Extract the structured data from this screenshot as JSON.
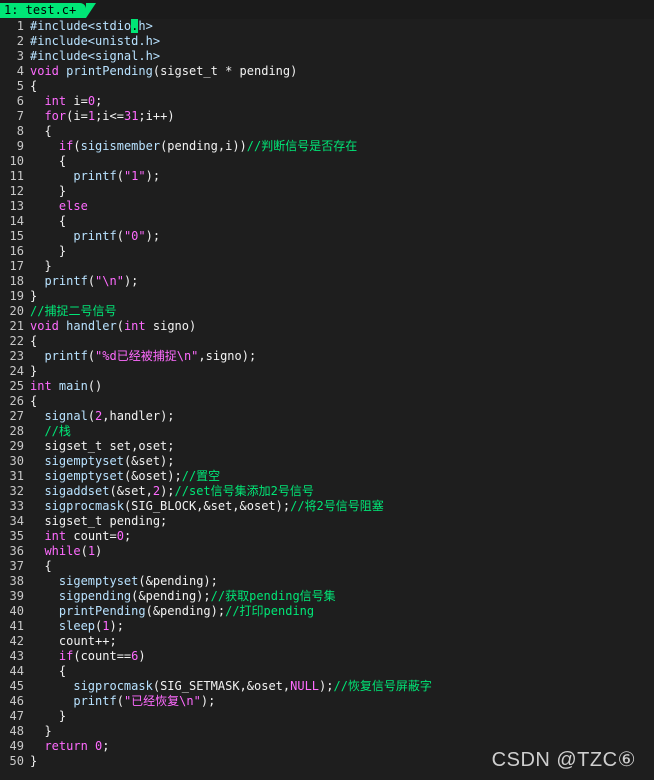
{
  "tab": {
    "label": "1: test.c+"
  },
  "lines": [
    {
      "n": "1",
      "tokens": [
        {
          "c": "pp",
          "t": "#include<stdio"
        },
        {
          "c": "cursor",
          "t": "."
        },
        {
          "c": "pp",
          "t": "h>"
        }
      ]
    },
    {
      "n": "2",
      "tokens": [
        {
          "c": "pp",
          "t": "#include<unistd.h>"
        }
      ]
    },
    {
      "n": "3",
      "tokens": [
        {
          "c": "pp",
          "t": "#include<signal.h>"
        }
      ]
    },
    {
      "n": "4",
      "tokens": [
        {
          "c": "kw",
          "t": "void"
        },
        {
          "c": "id",
          "t": " "
        },
        {
          "c": "fn",
          "t": "printPending"
        },
        {
          "c": "id",
          "t": "(sigset_t * pending)"
        }
      ]
    },
    {
      "n": "5",
      "tokens": [
        {
          "c": "id",
          "t": "{"
        }
      ]
    },
    {
      "n": "6",
      "tokens": [
        {
          "c": "id",
          "t": "  "
        },
        {
          "c": "kw",
          "t": "int"
        },
        {
          "c": "id",
          "t": " i="
        },
        {
          "c": "num",
          "t": "0"
        },
        {
          "c": "id",
          "t": ";"
        }
      ]
    },
    {
      "n": "7",
      "tokens": [
        {
          "c": "id",
          "t": "  "
        },
        {
          "c": "kw",
          "t": "for"
        },
        {
          "c": "id",
          "t": "(i="
        },
        {
          "c": "num",
          "t": "1"
        },
        {
          "c": "id",
          "t": ";i<="
        },
        {
          "c": "num",
          "t": "31"
        },
        {
          "c": "id",
          "t": ";i++)"
        }
      ]
    },
    {
      "n": "8",
      "tokens": [
        {
          "c": "id",
          "t": "  {"
        }
      ]
    },
    {
      "n": "9",
      "tokens": [
        {
          "c": "id",
          "t": "    "
        },
        {
          "c": "kw",
          "t": "if"
        },
        {
          "c": "id",
          "t": "("
        },
        {
          "c": "fn",
          "t": "sigismember"
        },
        {
          "c": "id",
          "t": "(pending,i))"
        },
        {
          "c": "cmt",
          "t": "//判断信号是否存在"
        }
      ]
    },
    {
      "n": "10",
      "tokens": [
        {
          "c": "id",
          "t": "    {"
        }
      ]
    },
    {
      "n": "11",
      "tokens": [
        {
          "c": "id",
          "t": "      "
        },
        {
          "c": "fn",
          "t": "printf"
        },
        {
          "c": "id",
          "t": "("
        },
        {
          "c": "str",
          "t": "\"1\""
        },
        {
          "c": "id",
          "t": ");"
        }
      ]
    },
    {
      "n": "12",
      "tokens": [
        {
          "c": "id",
          "t": "    }"
        }
      ]
    },
    {
      "n": "13",
      "tokens": [
        {
          "c": "id",
          "t": "    "
        },
        {
          "c": "kw",
          "t": "else"
        }
      ]
    },
    {
      "n": "14",
      "tokens": [
        {
          "c": "id",
          "t": "    {"
        }
      ]
    },
    {
      "n": "15",
      "tokens": [
        {
          "c": "id",
          "t": "      "
        },
        {
          "c": "fn",
          "t": "printf"
        },
        {
          "c": "id",
          "t": "("
        },
        {
          "c": "str",
          "t": "\"0\""
        },
        {
          "c": "id",
          "t": ");"
        }
      ]
    },
    {
      "n": "16",
      "tokens": [
        {
          "c": "id",
          "t": "    }"
        }
      ]
    },
    {
      "n": "17",
      "tokens": [
        {
          "c": "id",
          "t": "  }"
        }
      ]
    },
    {
      "n": "18",
      "tokens": [
        {
          "c": "id",
          "t": "  "
        },
        {
          "c": "fn",
          "t": "printf"
        },
        {
          "c": "id",
          "t": "("
        },
        {
          "c": "str",
          "t": "\"\\n\""
        },
        {
          "c": "id",
          "t": ");"
        }
      ]
    },
    {
      "n": "19",
      "tokens": [
        {
          "c": "id",
          "t": "}"
        }
      ]
    },
    {
      "n": "20",
      "tokens": [
        {
          "c": "cmt",
          "t": "//捕捉二号信号"
        }
      ]
    },
    {
      "n": "21",
      "tokens": [
        {
          "c": "kw",
          "t": "void"
        },
        {
          "c": "id",
          "t": " "
        },
        {
          "c": "fn",
          "t": "handler"
        },
        {
          "c": "id",
          "t": "("
        },
        {
          "c": "kw",
          "t": "int"
        },
        {
          "c": "id",
          "t": " signo)"
        }
      ]
    },
    {
      "n": "22",
      "tokens": [
        {
          "c": "id",
          "t": "{"
        }
      ]
    },
    {
      "n": "23",
      "tokens": [
        {
          "c": "id",
          "t": "  "
        },
        {
          "c": "fn",
          "t": "printf"
        },
        {
          "c": "id",
          "t": "("
        },
        {
          "c": "str",
          "t": "\"%d已经被捕捉\\n\""
        },
        {
          "c": "id",
          "t": ",signo);"
        }
      ]
    },
    {
      "n": "24",
      "tokens": [
        {
          "c": "id",
          "t": "}"
        }
      ]
    },
    {
      "n": "25",
      "tokens": [
        {
          "c": "kw",
          "t": "int"
        },
        {
          "c": "id",
          "t": " "
        },
        {
          "c": "fn",
          "t": "main"
        },
        {
          "c": "id",
          "t": "()"
        }
      ]
    },
    {
      "n": "26",
      "tokens": [
        {
          "c": "id",
          "t": "{"
        }
      ]
    },
    {
      "n": "27",
      "tokens": [
        {
          "c": "id",
          "t": "  "
        },
        {
          "c": "fn",
          "t": "signal"
        },
        {
          "c": "id",
          "t": "("
        },
        {
          "c": "num",
          "t": "2"
        },
        {
          "c": "id",
          "t": ",handler);"
        }
      ]
    },
    {
      "n": "28",
      "tokens": [
        {
          "c": "id",
          "t": "  "
        },
        {
          "c": "cmt",
          "t": "//栈"
        }
      ]
    },
    {
      "n": "29",
      "tokens": [
        {
          "c": "id",
          "t": "  sigset_t set,oset;"
        }
      ]
    },
    {
      "n": "30",
      "tokens": [
        {
          "c": "id",
          "t": "  "
        },
        {
          "c": "fn",
          "t": "sigemptyset"
        },
        {
          "c": "id",
          "t": "(&set);"
        }
      ]
    },
    {
      "n": "31",
      "tokens": [
        {
          "c": "id",
          "t": "  "
        },
        {
          "c": "fn",
          "t": "sigemptyset"
        },
        {
          "c": "id",
          "t": "(&oset);"
        },
        {
          "c": "cmt",
          "t": "//置空"
        }
      ]
    },
    {
      "n": "32",
      "tokens": [
        {
          "c": "id",
          "t": "  "
        },
        {
          "c": "fn",
          "t": "sigaddset"
        },
        {
          "c": "id",
          "t": "(&set,"
        },
        {
          "c": "num",
          "t": "2"
        },
        {
          "c": "id",
          "t": ");"
        },
        {
          "c": "cmt",
          "t": "//set信号集添加2号信号"
        }
      ]
    },
    {
      "n": "33",
      "tokens": [
        {
          "c": "id",
          "t": "  "
        },
        {
          "c": "fn",
          "t": "sigprocmask"
        },
        {
          "c": "id",
          "t": "(SIG_BLOCK,&set,&oset);"
        },
        {
          "c": "cmt",
          "t": "//将2号信号阻塞"
        }
      ]
    },
    {
      "n": "34",
      "tokens": [
        {
          "c": "id",
          "t": "  sigset_t pending;"
        }
      ]
    },
    {
      "n": "35",
      "tokens": [
        {
          "c": "id",
          "t": "  "
        },
        {
          "c": "kw",
          "t": "int"
        },
        {
          "c": "id",
          "t": " count="
        },
        {
          "c": "num",
          "t": "0"
        },
        {
          "c": "id",
          "t": ";"
        }
      ]
    },
    {
      "n": "36",
      "tokens": [
        {
          "c": "id",
          "t": "  "
        },
        {
          "c": "kw",
          "t": "while"
        },
        {
          "c": "id",
          "t": "("
        },
        {
          "c": "num",
          "t": "1"
        },
        {
          "c": "id",
          "t": ")"
        }
      ]
    },
    {
      "n": "37",
      "tokens": [
        {
          "c": "id",
          "t": "  {"
        }
      ]
    },
    {
      "n": "38",
      "tokens": [
        {
          "c": "id",
          "t": "    "
        },
        {
          "c": "fn",
          "t": "sigemptyset"
        },
        {
          "c": "id",
          "t": "(&pending);"
        }
      ]
    },
    {
      "n": "39",
      "tokens": [
        {
          "c": "id",
          "t": "    "
        },
        {
          "c": "fn",
          "t": "sigpending"
        },
        {
          "c": "id",
          "t": "(&pending);"
        },
        {
          "c": "cmt",
          "t": "//获取pending信号集"
        }
      ]
    },
    {
      "n": "40",
      "tokens": [
        {
          "c": "id",
          "t": "    "
        },
        {
          "c": "fn",
          "t": "printPending"
        },
        {
          "c": "id",
          "t": "(&pending);"
        },
        {
          "c": "cmt",
          "t": "//打印pending"
        }
      ]
    },
    {
      "n": "41",
      "tokens": [
        {
          "c": "id",
          "t": "    "
        },
        {
          "c": "fn",
          "t": "sleep"
        },
        {
          "c": "id",
          "t": "("
        },
        {
          "c": "num",
          "t": "1"
        },
        {
          "c": "id",
          "t": ");"
        }
      ]
    },
    {
      "n": "42",
      "tokens": [
        {
          "c": "id",
          "t": "    count++;"
        }
      ]
    },
    {
      "n": "43",
      "tokens": [
        {
          "c": "id",
          "t": "    "
        },
        {
          "c": "kw",
          "t": "if"
        },
        {
          "c": "id",
          "t": "(count=="
        },
        {
          "c": "num",
          "t": "6"
        },
        {
          "c": "id",
          "t": ")"
        }
      ]
    },
    {
      "n": "44",
      "tokens": [
        {
          "c": "id",
          "t": "    {"
        }
      ]
    },
    {
      "n": "45",
      "tokens": [
        {
          "c": "id",
          "t": "      "
        },
        {
          "c": "fn",
          "t": "sigprocmask"
        },
        {
          "c": "id",
          "t": "(SIG_SETMASK,&oset,"
        },
        {
          "c": "num",
          "t": "NULL"
        },
        {
          "c": "id",
          "t": ");"
        },
        {
          "c": "cmt",
          "t": "//恢复信号屏蔽字"
        }
      ]
    },
    {
      "n": "46",
      "tokens": [
        {
          "c": "id",
          "t": "      "
        },
        {
          "c": "fn",
          "t": "printf"
        },
        {
          "c": "id",
          "t": "("
        },
        {
          "c": "str",
          "t": "\"已经恢复\\n\""
        },
        {
          "c": "id",
          "t": ");"
        }
      ]
    },
    {
      "n": "47",
      "tokens": [
        {
          "c": "id",
          "t": "    }"
        }
      ]
    },
    {
      "n": "48",
      "tokens": [
        {
          "c": "id",
          "t": "  }"
        }
      ]
    },
    {
      "n": "49",
      "tokens": [
        {
          "c": "id",
          "t": "  "
        },
        {
          "c": "kw",
          "t": "return"
        },
        {
          "c": "id",
          "t": " "
        },
        {
          "c": "num",
          "t": "0"
        },
        {
          "c": "id",
          "t": ";"
        }
      ]
    },
    {
      "n": "50",
      "tokens": [
        {
          "c": "id",
          "t": "}"
        }
      ]
    }
  ],
  "watermark": "CSDN @TZC⑥",
  "colors": {
    "background": "#1e1e1e",
    "tab_active": "#00e676",
    "keyword": "#ff6bff",
    "comment": "#00e676",
    "preprocessor": "#b8e2ff"
  }
}
